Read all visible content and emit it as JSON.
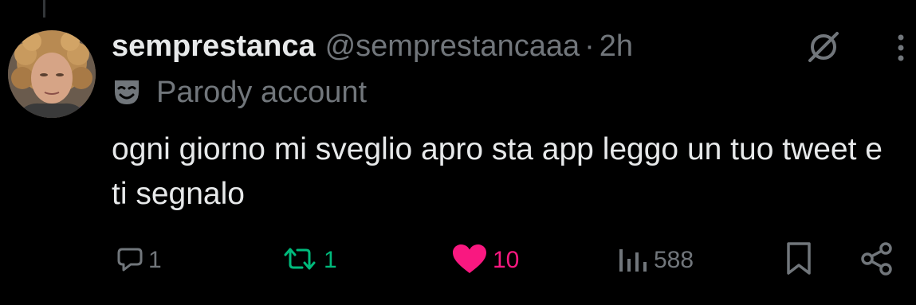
{
  "tweet": {
    "display_name": "semprestanca",
    "handle": "@semprestancaaa",
    "separator": "·",
    "time": "2h",
    "label_icon": "parody-mask-icon",
    "label_text": "Parody account",
    "text": "ogni giorno mi sveglio apro sta app leggo un tuo tweet e ti segnalo"
  },
  "actions": {
    "reply_count": "1",
    "repost_count": "1",
    "like_count": "10",
    "views_count": "588"
  },
  "colors": {
    "background": "#000000",
    "primary_text": "#e7e9ea",
    "secondary_text": "#71767b",
    "repost_active": "#00ba7c",
    "like_active": "#f91880"
  },
  "icons": {
    "top_right": [
      "grok-icon",
      "more-icon"
    ],
    "action_bar": [
      "reply-icon",
      "repost-icon",
      "like-icon",
      "views-icon",
      "bookmark-icon",
      "share-icon"
    ]
  }
}
